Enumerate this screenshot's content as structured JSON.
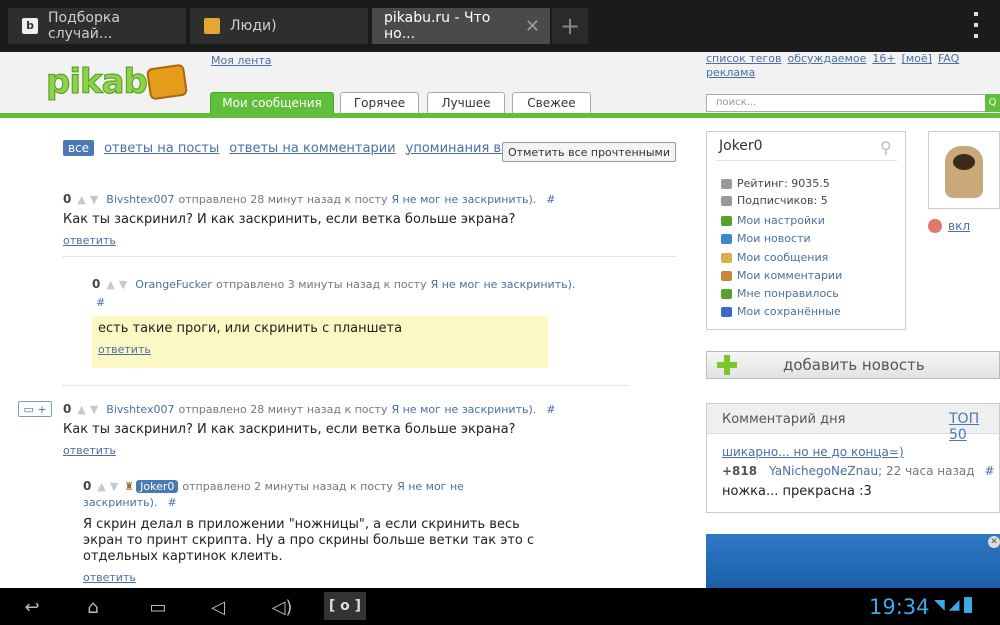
{
  "browser": {
    "tabs": [
      {
        "label": "Подборка случай...",
        "active": false
      },
      {
        "label": "Люди)",
        "active": false
      },
      {
        "label": "pikabu.ru - Что но...",
        "active": true
      }
    ],
    "close_glyph": "✕",
    "new_tab_glyph": "+"
  },
  "header": {
    "logo_text": "pikabu",
    "my_feed": "Моя лента",
    "tabs": [
      "Мои сообщения",
      "Горячее",
      "Лучшее",
      "Свежее"
    ],
    "top_links": [
      "список тегов",
      "обсуждаемое",
      "16+",
      "[моё]",
      "FAQ",
      "реклама"
    ],
    "search_placeholder": "поиск...",
    "search_button": "Q"
  },
  "filters": {
    "all": "все",
    "links": [
      "ответы на посты",
      "ответы на комментарии",
      "упоминания вас"
    ],
    "mark_read": "Отметить все прочтенными"
  },
  "comments": [
    {
      "score": "0",
      "author": "Bivshtex007",
      "meta": "отправлено 28 минут назад к посту",
      "post": "Я не мог не заскринить).",
      "hash": "#",
      "text": "Как ты заскринил? И как заскринить, если ветка больше экрана?",
      "reply": "ответить"
    },
    {
      "score": "0",
      "author": "OrangeFucker",
      "meta": "отправлено 3 минуты назад к посту",
      "post": "Я не мог не заскринить).",
      "hash": "#",
      "text": "есть такие проги, или скринить с планшета",
      "reply": "ответить"
    },
    {
      "score": "0",
      "author": "Bivshtex007",
      "meta": "отправлено 28 минут назад к посту",
      "post": "Я не мог не заскринить).",
      "hash": "#",
      "text": "Как ты заскринил? И как заскринить, если ветка больше экрана?",
      "reply": "ответить"
    },
    {
      "score": "0",
      "author": "Joker0",
      "meta": "отправлено 2 минуты назад к посту",
      "post": "Я не мог не",
      "post_cont": "заскринить).",
      "hash": "#",
      "text_lines": [
        "Я скрин делал в приложении \"ножницы\", а если скринить весь",
        "экран то принт скрипта. Ну а про скрины больше ветки так это с",
        "отдельных картинок клеить."
      ],
      "reply": "ответить"
    }
  ],
  "reply_widget": "▭ +",
  "user": {
    "name": "Joker0",
    "rating": "Рейтинг: 9035.5",
    "subscribers": "Подписчиков: 5",
    "links": [
      {
        "label": "Мои настройки",
        "icon": "gear-icon",
        "color": "#5aa02c"
      },
      {
        "label": "Мои новости",
        "icon": "news-icon",
        "color": "#3c8ac9"
      },
      {
        "label": "Мои сообщения",
        "icon": "envelope-icon",
        "color": "#d9b04a"
      },
      {
        "label": "Мои комментарии",
        "icon": "comments-icon",
        "color": "#c9873c"
      },
      {
        "label": "Мне понравилось",
        "icon": "thumb-up-icon",
        "color": "#5aa02c"
      },
      {
        "label": "Мои сохранённые",
        "icon": "save-icon",
        "color": "#3c6ac9"
      }
    ],
    "vkl": "вкл"
  },
  "sidebar": {
    "add_news": "добавить новость",
    "cotd_title": "Комментарий дня",
    "cotd_top": "ТОП 50",
    "cotd_link": "шикарно... но не до конца=)",
    "cotd_score": "+818",
    "cotd_author": "YaNichegoNeZnau",
    "cotd_time": "; 22 часа назад",
    "cotd_hash": "#",
    "cotd_text": "ножка... прекрасна :3"
  },
  "status": {
    "clock": "19:34"
  },
  "colors": {
    "accent_green": "#5fbf3a",
    "link_blue": "#4a6fa5",
    "highlight_yellow": "#fcf8c4",
    "clock_blue": "#3fa9e8"
  }
}
